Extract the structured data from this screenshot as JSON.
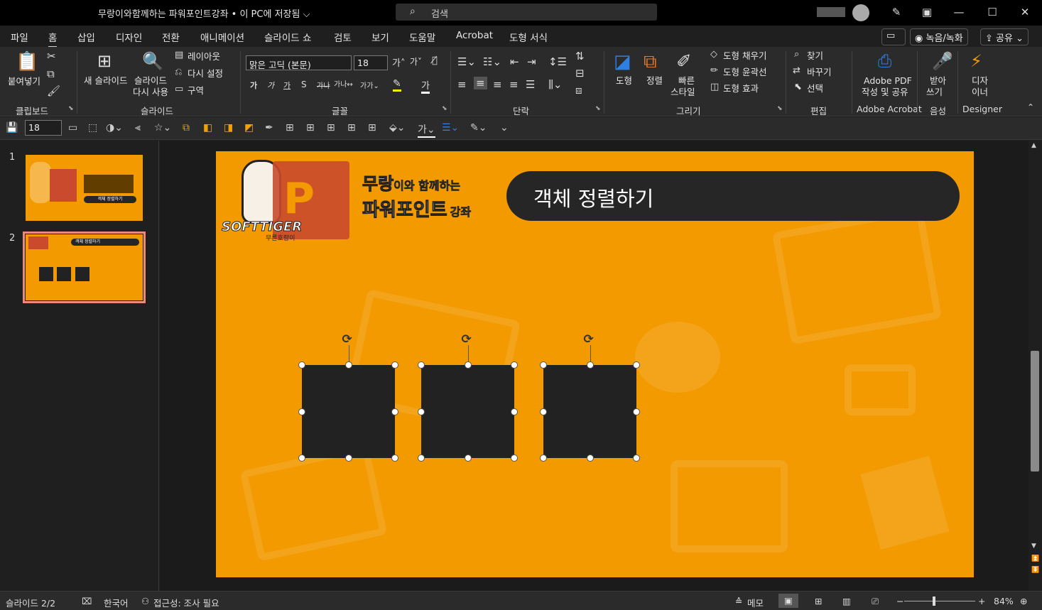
{
  "titlebar": {
    "doc_title": "무랑이와함께하는 파워포인트강좌 • 이 PC에 저장됨 ⌵",
    "search_placeholder": "검색"
  },
  "menu": {
    "items": [
      "파일",
      "홈",
      "삽입",
      "디자인",
      "전환",
      "애니메이션",
      "슬라이드 쇼",
      "검토",
      "보기",
      "도움말",
      "Acrobat",
      "도형 서식"
    ],
    "active": "홈",
    "record_label": "녹음/녹화",
    "share_label": "공유"
  },
  "ribbon": {
    "clipboard": {
      "paste": "붙여넣기",
      "group": "클립보드"
    },
    "slides": {
      "new_slide": "새 슬라이드",
      "reuse_1": "슬라이드",
      "reuse_2": "다시 사용",
      "layout": "레이아웃",
      "reset": "다시 설정",
      "section": "구역",
      "group": "슬라이드"
    },
    "font": {
      "name": "맑은 고딕 (본문)",
      "size": "18",
      "group": "글꼴"
    },
    "paragraph": {
      "group": "단락"
    },
    "drawing": {
      "shapes": "도형",
      "arrange": "정렬",
      "quick_1": "빠른",
      "quick_2": "스타일",
      "fill": "도형 채우기",
      "outline": "도형 윤곽선",
      "effects": "도형 효과",
      "group": "그리기"
    },
    "editing": {
      "find": "찾기",
      "replace": "바꾸기",
      "select": "선택",
      "group": "편집"
    },
    "acrobat": {
      "line1": "Adobe PDF",
      "line2": "작성 및 공유",
      "group": "Adobe Acrobat"
    },
    "voice": {
      "line1": "받아",
      "line2": "쓰기",
      "group": "음성"
    },
    "designer": {
      "line1": "디자",
      "line2": "이너",
      "group": "Designer"
    }
  },
  "quick_toolbar": {
    "font_size": "18"
  },
  "thumbnails": [
    {
      "number": "1",
      "pill": "객체 정렬하기"
    },
    {
      "number": "2",
      "pill": "객체 정렬하기"
    }
  ],
  "slide": {
    "logo_text": "SOFTTIGER",
    "logo_sub": "무른호랑이",
    "heading_line1": "무랑",
    "heading_line1_small": "이와 함께하는",
    "heading_line2": "파워포인트",
    "heading_line2_small": "강좌",
    "title": "객체 정렬하기"
  },
  "status": {
    "slide": "슬라이드 2/2",
    "language": "한국어",
    "accessibility": "접근성: 조사 필요",
    "notes": "메모",
    "zoom": "84%"
  },
  "colors": {
    "slide_bg": "#f29a00",
    "square": "#222222",
    "title_pill": "#262626",
    "thumb_selected": "#e88c7a"
  }
}
